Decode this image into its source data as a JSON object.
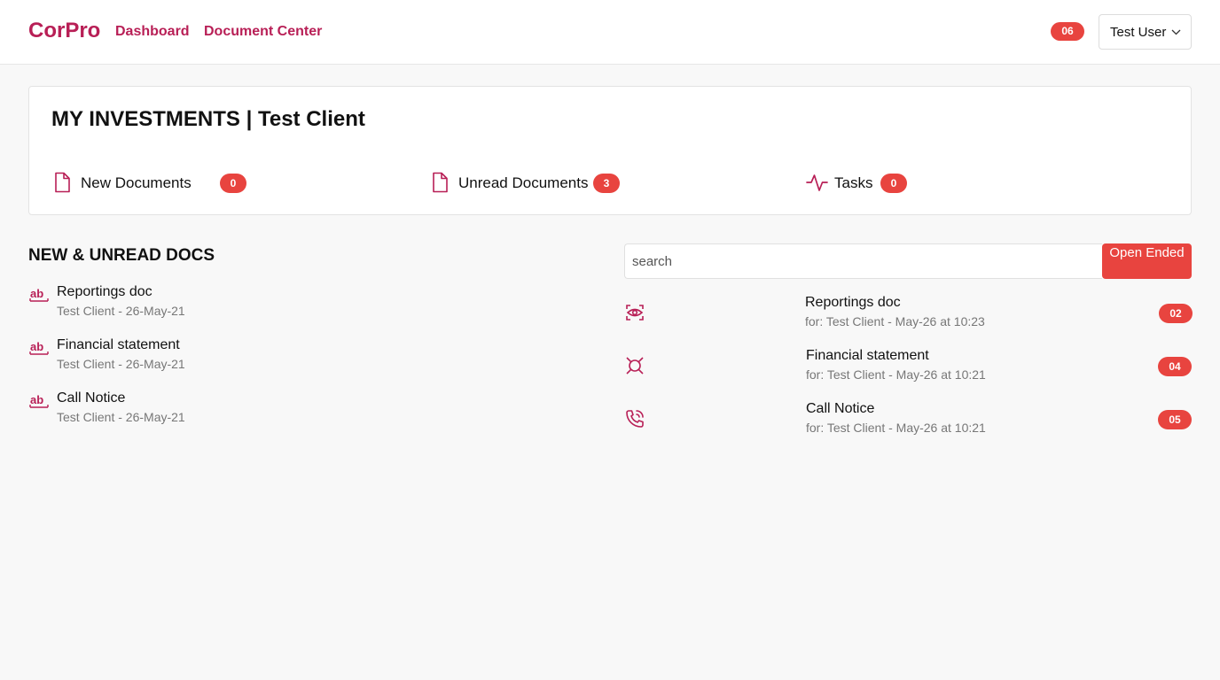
{
  "header": {
    "brand": "CorPro",
    "nav": [
      "Dashboard",
      "Document Center"
    ],
    "notification_count": "06",
    "user_name": "Test User",
    "accent_color": "#b81f56",
    "badge_color": "#e8443f"
  },
  "summary": {
    "title": "MY INVESTMENTS | Test Client",
    "stats": [
      {
        "label": "New Documents",
        "count": "0",
        "icon": "document-icon"
      },
      {
        "label": "Unread Documents",
        "count": "3",
        "icon": "document-icon"
      },
      {
        "label": "Tasks",
        "count": "0",
        "icon": "activity-icon"
      }
    ]
  },
  "docs": {
    "title": "NEW & UNREAD DOCS",
    "items": [
      {
        "name": "Reportings doc",
        "meta": "Test Client - 26-May-21",
        "icon": "text-ab-icon"
      },
      {
        "name": "Financial statement",
        "meta": "Test Client - 26-May-21",
        "icon": "text-ab-icon"
      },
      {
        "name": "Call Notice",
        "meta": "Test Client - 26-May-21",
        "icon": "text-ab-icon"
      }
    ]
  },
  "activity": {
    "search_placeholder": "search",
    "button_label": "Open Ended",
    "items": [
      {
        "name": "Reportings doc",
        "meta": "for: Test Client - May-26 at 10:23",
        "badge": "02",
        "icon": "eye-icon"
      },
      {
        "name": "Financial statement",
        "meta": "for: Test Client - May-26 at 10:21",
        "badge": "04",
        "icon": "currency-icon"
      },
      {
        "name": "Call Notice",
        "meta": "for: Test Client - May-26 at 10:21",
        "badge": "05",
        "icon": "phone-call-icon"
      }
    ]
  }
}
